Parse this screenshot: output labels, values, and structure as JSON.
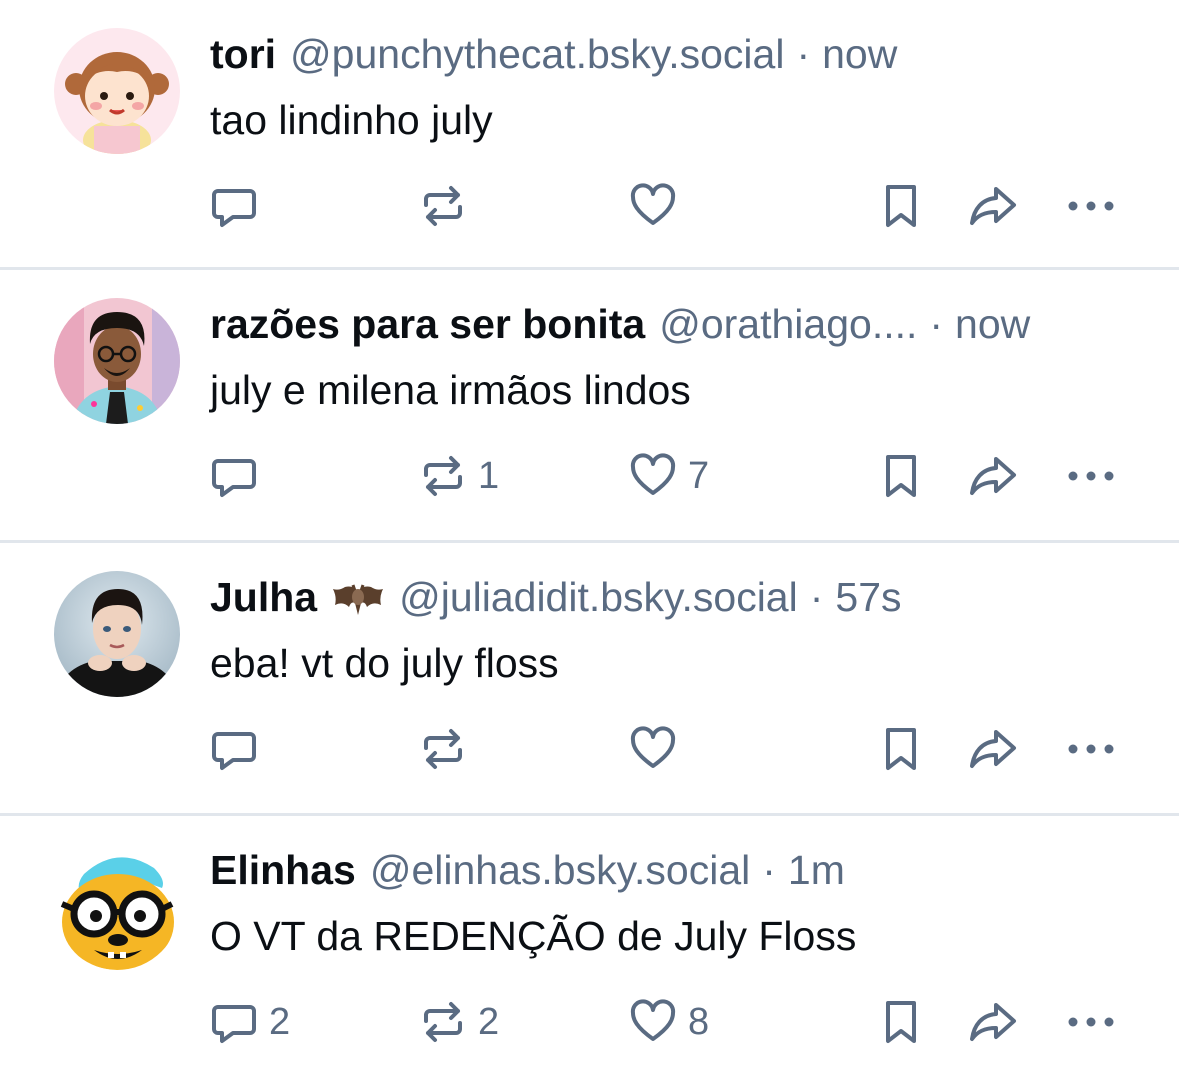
{
  "posts": [
    {
      "display_name": "tori",
      "handle": "@punchythecat.bsky.social",
      "separator": "·",
      "time": "now",
      "emoji": "",
      "text": "tao lindinho july",
      "avatar_icon": "cartoon-girl-avatar",
      "counts": {
        "replies": "",
        "reposts": "",
        "likes": ""
      }
    },
    {
      "display_name": "razões para ser bonita",
      "handle": "@orathiago....",
      "separator": "·",
      "time": "now",
      "emoji": "",
      "text": "july e milena irmãos lindos",
      "avatar_icon": "man-with-glasses-avatar",
      "counts": {
        "replies": "",
        "reposts": "1",
        "likes": "7"
      }
    },
    {
      "display_name": "Julha",
      "handle": "@juliadidit.bsky.social",
      "separator": "·",
      "time": "57s",
      "emoji": "bat-emoji",
      "text": "eba! vt do july floss",
      "avatar_icon": "man-dark-hair-avatar",
      "counts": {
        "replies": "",
        "reposts": "",
        "likes": ""
      }
    },
    {
      "display_name": "Elinhas",
      "handle": "@elinhas.bsky.social",
      "separator": "·",
      "time": "1m",
      "emoji": "",
      "text": "O VT da REDENÇÃO de July Floss",
      "avatar_icon": "cartoon-dog-glasses-avatar",
      "counts": {
        "replies": "2",
        "reposts": "2",
        "likes": "8"
      }
    }
  ],
  "icons": {
    "reply": "reply-icon",
    "repost": "repost-icon",
    "like": "heart-icon",
    "bookmark": "bookmark-icon",
    "share": "share-icon",
    "more": "more-icon"
  },
  "colors": {
    "text": "#0b0f14",
    "muted": "#5a6b82",
    "divider": "#e1e6ec",
    "background": "#ffffff"
  }
}
